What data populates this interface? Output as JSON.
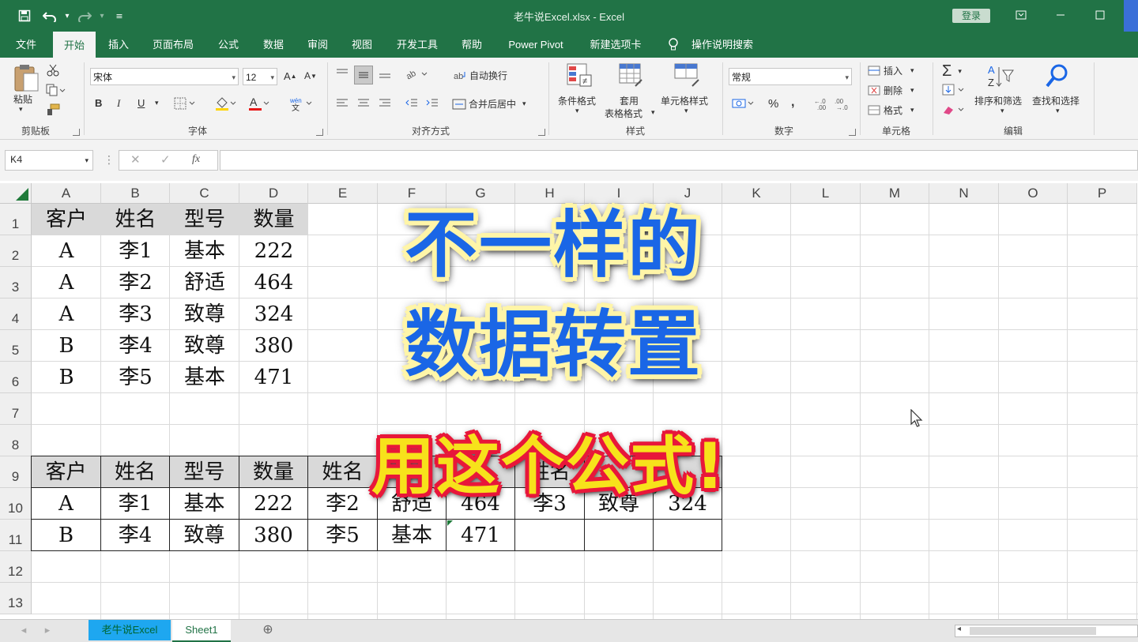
{
  "titlebar": {
    "title": "老牛说Excel.xlsx  -  Excel",
    "login": "登录"
  },
  "tabs": [
    "文件",
    "开始",
    "插入",
    "页面布局",
    "公式",
    "数据",
    "审阅",
    "视图",
    "开发工具",
    "帮助",
    "Power Pivot",
    "新建选项卡",
    "操作说明搜索"
  ],
  "active_tab": "开始",
  "ribbon": {
    "clipboard": {
      "paste": "粘贴",
      "label": "剪贴板"
    },
    "font": {
      "name": "宋体",
      "size": "12",
      "bold": "B",
      "italic": "I",
      "underline": "U",
      "label": "字体"
    },
    "alignment": {
      "wrap": "自动换行",
      "merge": "合并后居中",
      "label": "对齐方式"
    },
    "styles": {
      "conditional": "条件格式",
      "table_line1": "套用",
      "table_line2": "表格格式",
      "cell_styles": "单元格样式",
      "label": "样式"
    },
    "number": {
      "format": "常规",
      "percent": "%",
      "comma": ",",
      "label": "数字"
    },
    "cells": {
      "insert": "插入",
      "delete": "删除",
      "format": "格式",
      "label": "单元格"
    },
    "editing": {
      "sort": "排序和筛选",
      "find": "查找和选择",
      "label": "编辑"
    }
  },
  "formula_bar": {
    "name_box": "K4",
    "formula": ""
  },
  "grid": {
    "columns": [
      "A",
      "B",
      "C",
      "D",
      "E",
      "F",
      "G",
      "H",
      "I",
      "J",
      "K",
      "L",
      "M",
      "N",
      "O",
      "P"
    ],
    "rows": [
      "1",
      "2",
      "3",
      "4",
      "5",
      "6",
      "7",
      "8",
      "9",
      "10",
      "11",
      "12",
      "13"
    ],
    "table1": {
      "headers": [
        "客户",
        "姓名",
        "型号",
        "数量"
      ],
      "rows": [
        [
          "A",
          "李1",
          "基本",
          "222"
        ],
        [
          "A",
          "李2",
          "舒适",
          "464"
        ],
        [
          "A",
          "李3",
          "致尊",
          "324"
        ],
        [
          "B",
          "李4",
          "致尊",
          "380"
        ],
        [
          "B",
          "李5",
          "基本",
          "471"
        ]
      ]
    },
    "table2": {
      "headers": [
        "客户",
        "姓名",
        "型号",
        "数量",
        "姓名",
        "",
        "",
        "姓名",
        "",
        ""
      ],
      "rows": [
        [
          "A",
          "李1",
          "基本",
          "222",
          "李2",
          "舒适",
          "464",
          "李3",
          "致尊",
          "324"
        ],
        [
          "B",
          "李4",
          "致尊",
          "380",
          "李5",
          "基本",
          "471",
          "",
          "",
          ""
        ]
      ]
    }
  },
  "overlay": {
    "line1": "不一样的",
    "line2": "数据转置",
    "line3": "用这个公式!"
  },
  "sheets": [
    "老牛说Excel",
    "Sheet1"
  ],
  "colors": {
    "excel_green": "#217346",
    "overlay_blue": "#1a66e6",
    "overlay_yellow": "#f7e21b",
    "overlay_red": "#e8173a"
  }
}
